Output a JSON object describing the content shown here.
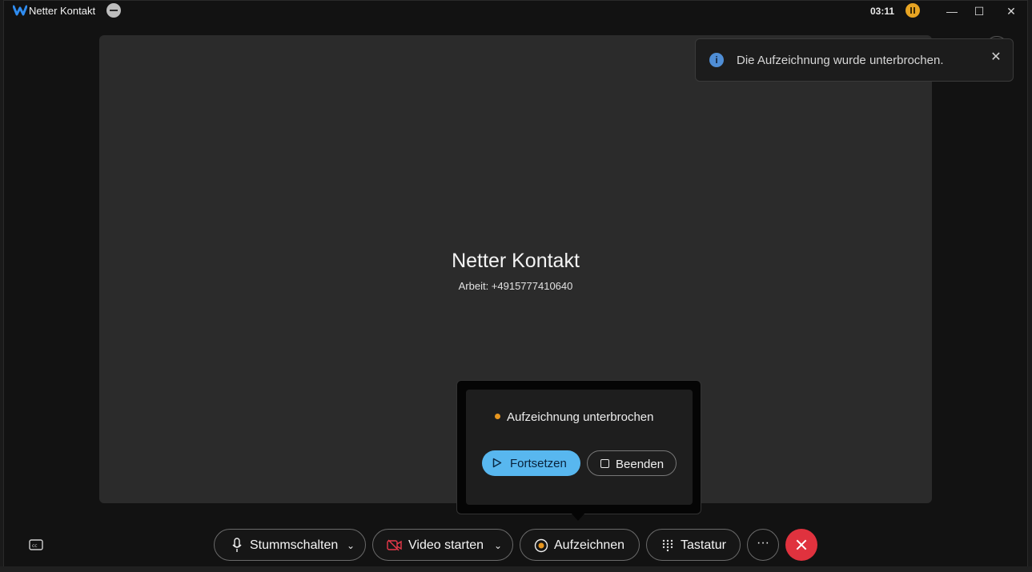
{
  "window": {
    "title": "Netter Kontakt",
    "timer": "03:11",
    "minimize": "—",
    "maximize": "☐",
    "close": "✕"
  },
  "call": {
    "contact_name": "Netter Kontakt",
    "contact_number": "Arbeit: +4915777410640"
  },
  "toast": {
    "message": "Die Aufzeichnung wurde unterbrochen.",
    "icon": "i",
    "close": "✕"
  },
  "recording_popover": {
    "status": "Aufzeichnung unterbrochen",
    "resume_label": "Fortsetzen",
    "stop_label": "Beenden"
  },
  "controls": {
    "mute_label": "Stummschalten",
    "video_label": "Video starten",
    "record_label": "Aufzeichnen",
    "keypad_label": "Tastatur",
    "more_label": "···",
    "chevron": "⌄"
  },
  "colors": {
    "accent": "#58b7ef",
    "recording_paused": "#e7961f",
    "hangup": "#e0323e",
    "info": "#4f8ed6"
  }
}
